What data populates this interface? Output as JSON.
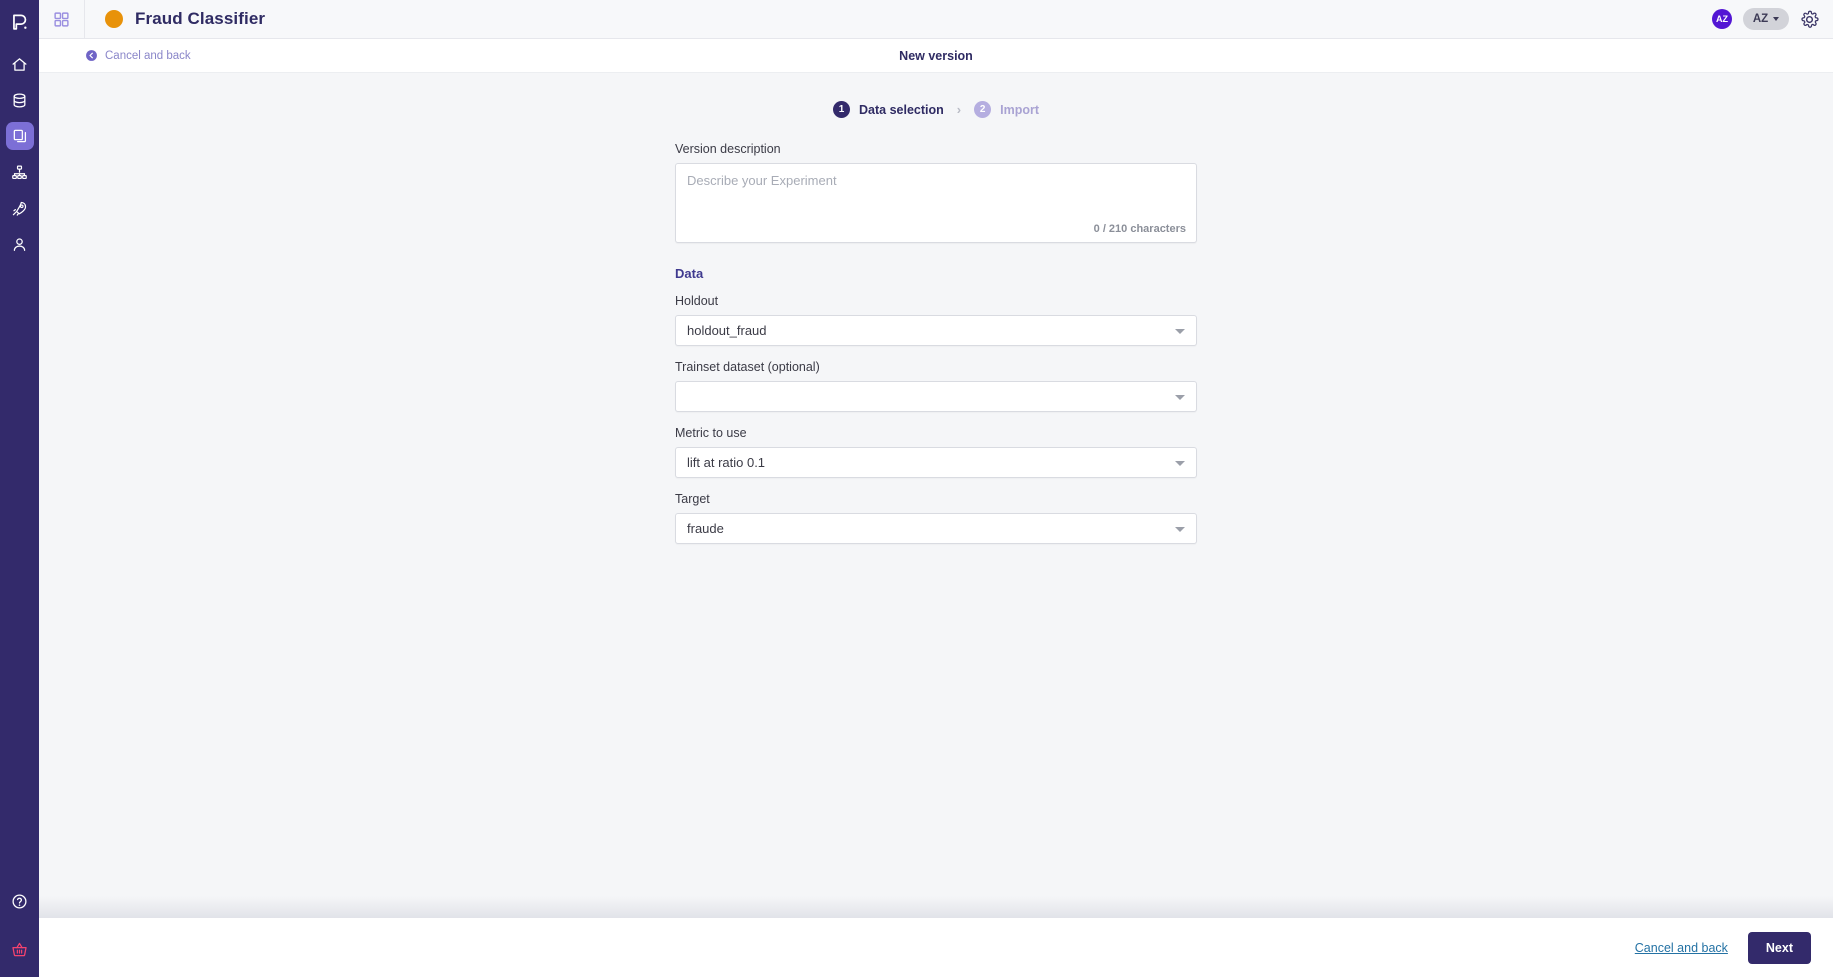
{
  "sidebar": {
    "logo_icon": "pecan-logo-icon",
    "items": [
      {
        "icon": "home-icon",
        "name": "home",
        "active": false
      },
      {
        "icon": "database-icon",
        "name": "datasets",
        "active": false
      },
      {
        "icon": "documents-icon",
        "name": "models",
        "active": true
      },
      {
        "icon": "hierarchy-icon",
        "name": "pipelines",
        "active": false
      },
      {
        "icon": "rocket-icon",
        "name": "deployments",
        "active": false
      },
      {
        "icon": "person-icon",
        "name": "account",
        "active": false
      }
    ],
    "bottom_items": [
      {
        "icon": "help-circle-icon",
        "name": "help"
      },
      {
        "icon": "basket-icon",
        "name": "marketplace"
      }
    ]
  },
  "topbar": {
    "grid_icon": "grid-apps-icon",
    "project_title": "Fraud Classifier",
    "project_dot_color": "#e8920a",
    "avatar_initials": "AZ",
    "avatar_color": "#5316d4",
    "workspace_label": "AZ",
    "gear_icon": "gear-icon"
  },
  "subheader": {
    "back_icon": "circle-back-arrow-icon",
    "back_label": "Cancel and back",
    "title": "New version"
  },
  "steps": [
    {
      "number": "1",
      "label": "Data selection",
      "state": "active"
    },
    {
      "number": "2",
      "label": "Import",
      "state": "inactive"
    }
  ],
  "step_separator": "›",
  "form": {
    "description": {
      "label": "Version description",
      "placeholder": "Describe your Experiment",
      "value": "",
      "counter": "0 / 210 characters"
    },
    "section_title": "Data",
    "fields": [
      {
        "label": "Holdout",
        "value": "holdout_fraud",
        "name": "holdout-select"
      },
      {
        "label": "Trainset dataset (optional)",
        "value": "",
        "name": "trainset-select"
      },
      {
        "label": "Metric to use",
        "value": "lift at ratio 0.1",
        "name": "metric-select"
      },
      {
        "label": "Target",
        "value": "fraude",
        "name": "target-select"
      }
    ]
  },
  "footer": {
    "cancel_label": "Cancel and back",
    "next_label": "Next"
  },
  "colors": {
    "sidebar": "#332a6b",
    "accent_purple": "#7c6fd6",
    "content_bg": "#f5f6f8",
    "link_blue": "#2472a4"
  }
}
